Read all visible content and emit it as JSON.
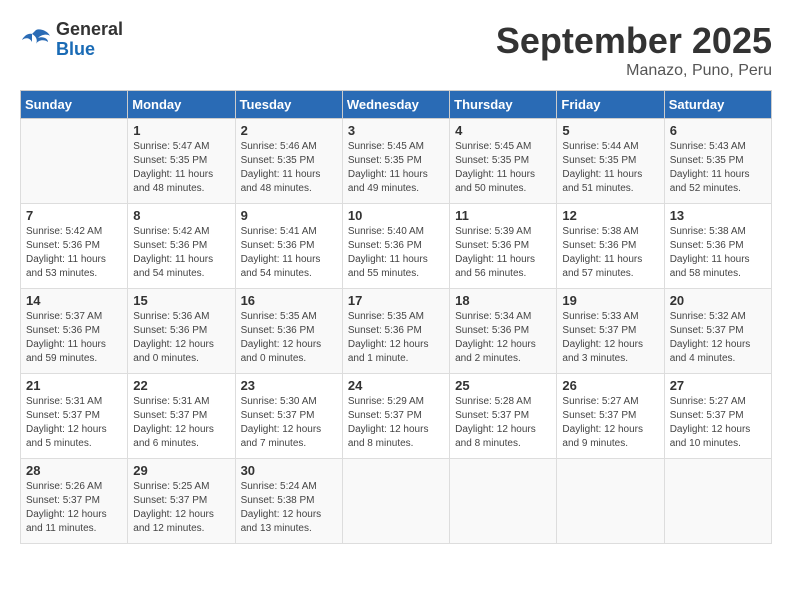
{
  "header": {
    "logo_general": "General",
    "logo_blue": "Blue",
    "month": "September 2025",
    "location": "Manazo, Puno, Peru"
  },
  "days_of_week": [
    "Sunday",
    "Monday",
    "Tuesday",
    "Wednesday",
    "Thursday",
    "Friday",
    "Saturday"
  ],
  "weeks": [
    [
      {
        "num": "",
        "detail": ""
      },
      {
        "num": "1",
        "detail": "Sunrise: 5:47 AM\nSunset: 5:35 PM\nDaylight: 11 hours\nand 48 minutes."
      },
      {
        "num": "2",
        "detail": "Sunrise: 5:46 AM\nSunset: 5:35 PM\nDaylight: 11 hours\nand 48 minutes."
      },
      {
        "num": "3",
        "detail": "Sunrise: 5:45 AM\nSunset: 5:35 PM\nDaylight: 11 hours\nand 49 minutes."
      },
      {
        "num": "4",
        "detail": "Sunrise: 5:45 AM\nSunset: 5:35 PM\nDaylight: 11 hours\nand 50 minutes."
      },
      {
        "num": "5",
        "detail": "Sunrise: 5:44 AM\nSunset: 5:35 PM\nDaylight: 11 hours\nand 51 minutes."
      },
      {
        "num": "6",
        "detail": "Sunrise: 5:43 AM\nSunset: 5:35 PM\nDaylight: 11 hours\nand 52 minutes."
      }
    ],
    [
      {
        "num": "7",
        "detail": "Sunrise: 5:42 AM\nSunset: 5:36 PM\nDaylight: 11 hours\nand 53 minutes."
      },
      {
        "num": "8",
        "detail": "Sunrise: 5:42 AM\nSunset: 5:36 PM\nDaylight: 11 hours\nand 54 minutes."
      },
      {
        "num": "9",
        "detail": "Sunrise: 5:41 AM\nSunset: 5:36 PM\nDaylight: 11 hours\nand 54 minutes."
      },
      {
        "num": "10",
        "detail": "Sunrise: 5:40 AM\nSunset: 5:36 PM\nDaylight: 11 hours\nand 55 minutes."
      },
      {
        "num": "11",
        "detail": "Sunrise: 5:39 AM\nSunset: 5:36 PM\nDaylight: 11 hours\nand 56 minutes."
      },
      {
        "num": "12",
        "detail": "Sunrise: 5:38 AM\nSunset: 5:36 PM\nDaylight: 11 hours\nand 57 minutes."
      },
      {
        "num": "13",
        "detail": "Sunrise: 5:38 AM\nSunset: 5:36 PM\nDaylight: 11 hours\nand 58 minutes."
      }
    ],
    [
      {
        "num": "14",
        "detail": "Sunrise: 5:37 AM\nSunset: 5:36 PM\nDaylight: 11 hours\nand 59 minutes."
      },
      {
        "num": "15",
        "detail": "Sunrise: 5:36 AM\nSunset: 5:36 PM\nDaylight: 12 hours\nand 0 minutes."
      },
      {
        "num": "16",
        "detail": "Sunrise: 5:35 AM\nSunset: 5:36 PM\nDaylight: 12 hours\nand 0 minutes."
      },
      {
        "num": "17",
        "detail": "Sunrise: 5:35 AM\nSunset: 5:36 PM\nDaylight: 12 hours\nand 1 minute."
      },
      {
        "num": "18",
        "detail": "Sunrise: 5:34 AM\nSunset: 5:36 PM\nDaylight: 12 hours\nand 2 minutes."
      },
      {
        "num": "19",
        "detail": "Sunrise: 5:33 AM\nSunset: 5:37 PM\nDaylight: 12 hours\nand 3 minutes."
      },
      {
        "num": "20",
        "detail": "Sunrise: 5:32 AM\nSunset: 5:37 PM\nDaylight: 12 hours\nand 4 minutes."
      }
    ],
    [
      {
        "num": "21",
        "detail": "Sunrise: 5:31 AM\nSunset: 5:37 PM\nDaylight: 12 hours\nand 5 minutes."
      },
      {
        "num": "22",
        "detail": "Sunrise: 5:31 AM\nSunset: 5:37 PM\nDaylight: 12 hours\nand 6 minutes."
      },
      {
        "num": "23",
        "detail": "Sunrise: 5:30 AM\nSunset: 5:37 PM\nDaylight: 12 hours\nand 7 minutes."
      },
      {
        "num": "24",
        "detail": "Sunrise: 5:29 AM\nSunset: 5:37 PM\nDaylight: 12 hours\nand 8 minutes."
      },
      {
        "num": "25",
        "detail": "Sunrise: 5:28 AM\nSunset: 5:37 PM\nDaylight: 12 hours\nand 8 minutes."
      },
      {
        "num": "26",
        "detail": "Sunrise: 5:27 AM\nSunset: 5:37 PM\nDaylight: 12 hours\nand 9 minutes."
      },
      {
        "num": "27",
        "detail": "Sunrise: 5:27 AM\nSunset: 5:37 PM\nDaylight: 12 hours\nand 10 minutes."
      }
    ],
    [
      {
        "num": "28",
        "detail": "Sunrise: 5:26 AM\nSunset: 5:37 PM\nDaylight: 12 hours\nand 11 minutes."
      },
      {
        "num": "29",
        "detail": "Sunrise: 5:25 AM\nSunset: 5:37 PM\nDaylight: 12 hours\nand 12 minutes."
      },
      {
        "num": "30",
        "detail": "Sunrise: 5:24 AM\nSunset: 5:38 PM\nDaylight: 12 hours\nand 13 minutes."
      },
      {
        "num": "",
        "detail": ""
      },
      {
        "num": "",
        "detail": ""
      },
      {
        "num": "",
        "detail": ""
      },
      {
        "num": "",
        "detail": ""
      }
    ]
  ]
}
